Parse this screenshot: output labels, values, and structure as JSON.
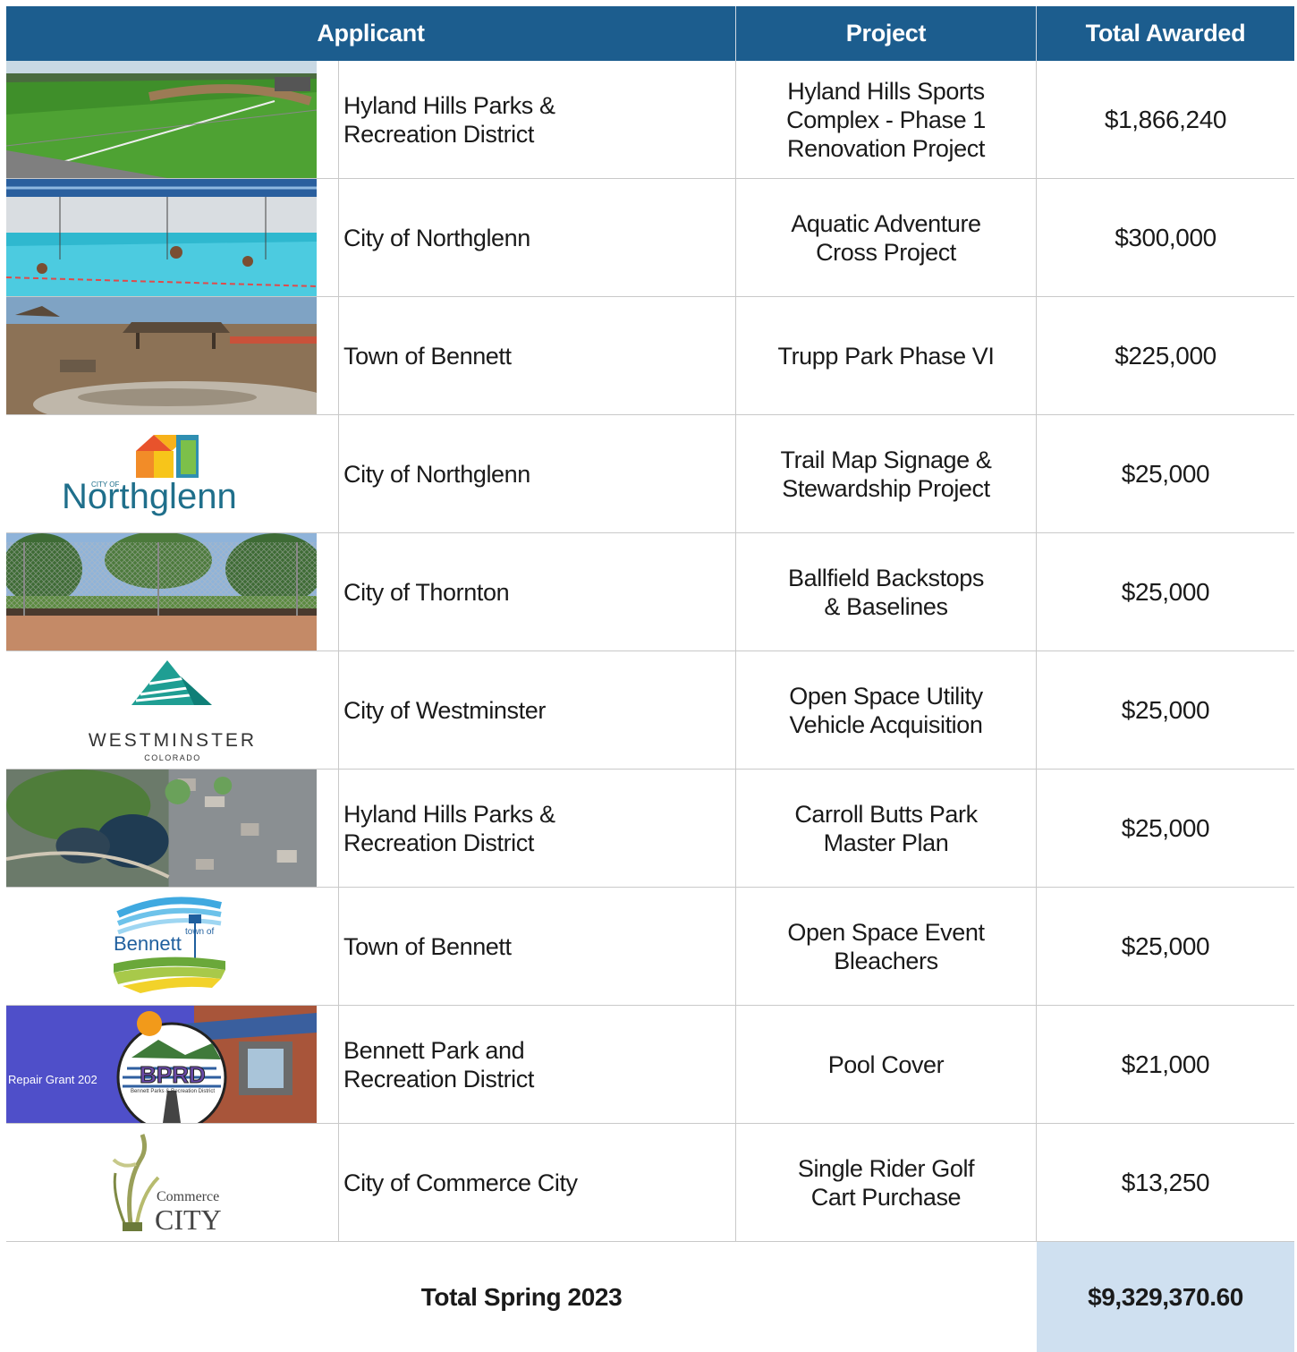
{
  "header": {
    "applicant": "Applicant",
    "project": "Project",
    "total": "Total Awarded"
  },
  "rows": [
    {
      "applicant": "Hyland Hills Parks &\nRecreation District",
      "project": "Hyland Hills Sports\nComplex - Phase 1\nRenovation Project",
      "total": "$1,866,240"
    },
    {
      "applicant": "City of Northglenn",
      "project": "Aquatic Adventure\nCross Project",
      "total": "$300,000"
    },
    {
      "applicant": "Town of Bennett",
      "project": "Trupp Park Phase VI",
      "total": "$225,000"
    },
    {
      "applicant": "City of Northglenn",
      "project": "Trail Map Signage &\nStewardship Project",
      "total": "$25,000"
    },
    {
      "applicant": "City of Thornton",
      "project": "Ballfield Backstops\n& Baselines",
      "total": "$25,000"
    },
    {
      "applicant": "City of Westminster",
      "project": "Open Space Utility\nVehicle Acquisition",
      "total": "$25,000"
    },
    {
      "applicant": "Hyland Hills Parks &\nRecreation District",
      "project": "Carroll Butts Park\nMaster Plan",
      "total": "$25,000"
    },
    {
      "applicant": "Town of Bennett",
      "project": "Open Space Event\nBleachers",
      "total": "$25,000"
    },
    {
      "applicant": "Bennett Park and\nRecreation District",
      "project": "Pool Cover",
      "total": "$21,000"
    },
    {
      "applicant": "City of Commerce City",
      "project": "Single Rider Golf\nCart Purchase",
      "total": "$13,250"
    }
  ],
  "logos": {
    "northglenn_small": "CITY OF",
    "northglenn_name": "Northglenn",
    "westminster_name": "WESTMINSTER",
    "westminster_state": "COLORADO",
    "bennett_small": "town of",
    "bennett_name": "Bennett",
    "bprd_caption": "Repair Grant 202",
    "bprd_letters": "BPRD",
    "bprd_sub": "Bennett Parks & Recreation District",
    "commerce_small": "Commerce",
    "commerce_name": "CITY"
  },
  "footer": {
    "label": "Total Spring 2023",
    "total": "$9,329,370.60"
  },
  "colors": {
    "header_bg": "#1c5d8e",
    "footer_total_bg": "#cfe0f0"
  }
}
